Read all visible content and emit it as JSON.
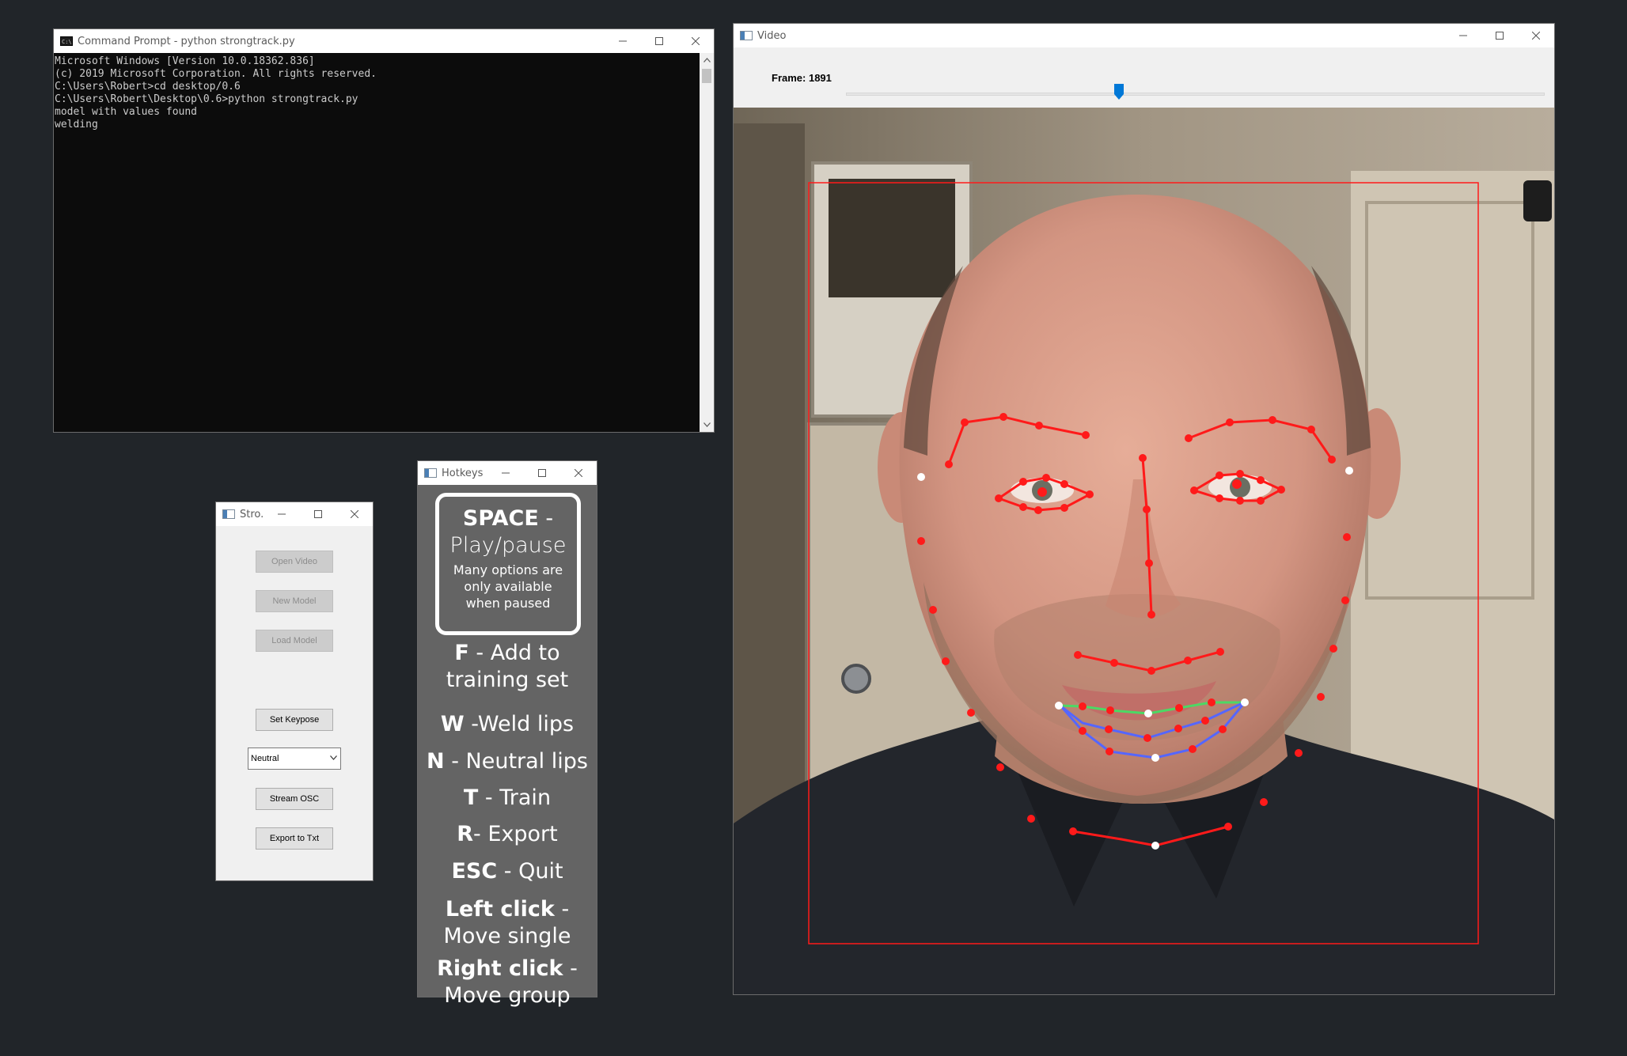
{
  "cmd_window": {
    "title": "Command Prompt - python  strongtrack.py",
    "lines": [
      "Microsoft Windows [Version 10.0.18362.836]",
      "(c) 2019 Microsoft Corporation. All rights reserved.",
      "",
      "C:\\Users\\Robert>cd desktop/0.6",
      "",
      "C:\\Users\\Robert\\Desktop\\0.6>python strongtrack.py",
      "model with values found",
      "welding"
    ]
  },
  "strong_window": {
    "title": "Stro...",
    "buttons": {
      "open_video": "Open Video",
      "new_model": "New Model",
      "load_model": "Load Model",
      "set_keypose": "Set Keypose",
      "stream_osc": "Stream OSC",
      "export_txt": "Export to Txt"
    },
    "keypose_select": "Neutral"
  },
  "hotkeys_window": {
    "title": "Hotkeys",
    "space": {
      "key": "SPACE",
      "dash": " -",
      "action": "Play/pause",
      "note": "Many options are only available when paused"
    },
    "items": [
      {
        "key": "F",
        "dash": " - ",
        "action": "Add to training set"
      },
      {
        "key": "W",
        "dash": " -",
        "action": "Weld lips"
      },
      {
        "key": "N",
        "dash": " - ",
        "action": "Neutral lips"
      },
      {
        "key": "T",
        "dash": " - ",
        "action": "Train"
      },
      {
        "key": "R",
        "dash": "- ",
        "action": "Export"
      },
      {
        "key": "ESC",
        "dash": " - ",
        "action": "Quit"
      },
      {
        "key": "Left click",
        "dash": " -",
        "action": "Move single"
      },
      {
        "key": "Right click",
        "dash": " -",
        "action": "Move group"
      }
    ]
  },
  "video_window": {
    "title": "Video",
    "frame_label": "Frame: 1891",
    "slider_position": 0.39
  },
  "colors": {
    "desktop_bg": "#212529",
    "hotkeys_bg": "#646464",
    "landmark_red": "#ff1a1a",
    "lip_green": "#4cd964",
    "lip_blue": "#5566ff",
    "slider_blue": "#0078d7"
  }
}
